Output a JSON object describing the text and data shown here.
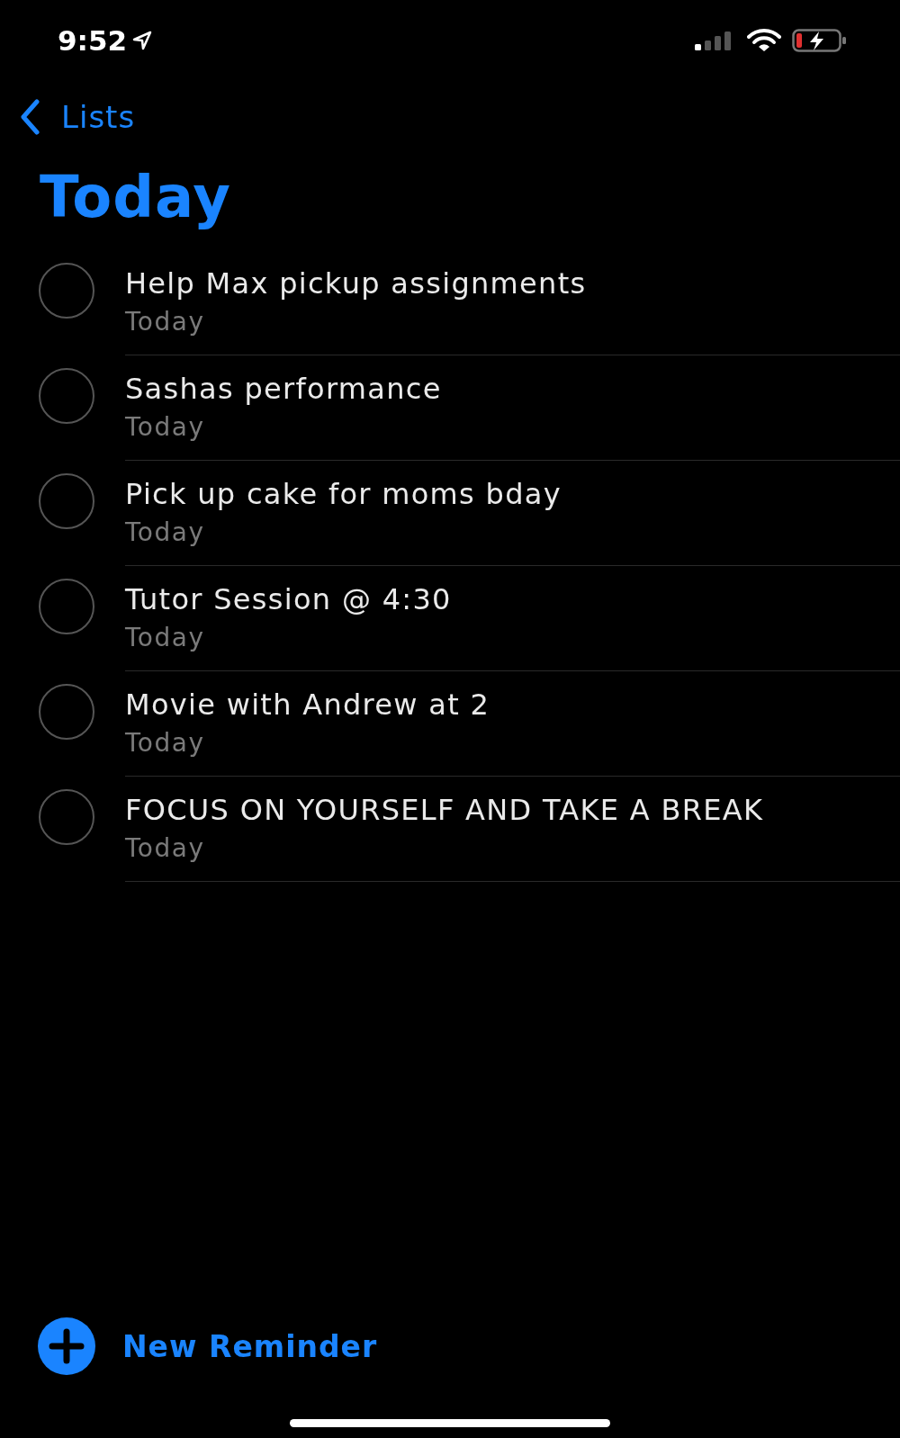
{
  "status_bar": {
    "time": "9:52"
  },
  "nav": {
    "back_label": "Lists"
  },
  "title": "Today",
  "reminders": [
    {
      "title": "Help Max pickup assignments",
      "due": "Today",
      "checked": false
    },
    {
      "title": "Sashas performance",
      "due": "Today",
      "checked": false
    },
    {
      "title": "Pick up cake for moms bday",
      "due": "Today",
      "checked": false
    },
    {
      "title": "Tutor Session @ 4:30",
      "due": "Today",
      "checked": false
    },
    {
      "title": "Movie with Andrew at 2",
      "due": "Today",
      "checked": false
    },
    {
      "title": "FOCUS ON YOURSELF AND TAKE A BREAK",
      "due": "Today",
      "checked": false
    }
  ],
  "new_reminder": {
    "label": "New Reminder"
  }
}
